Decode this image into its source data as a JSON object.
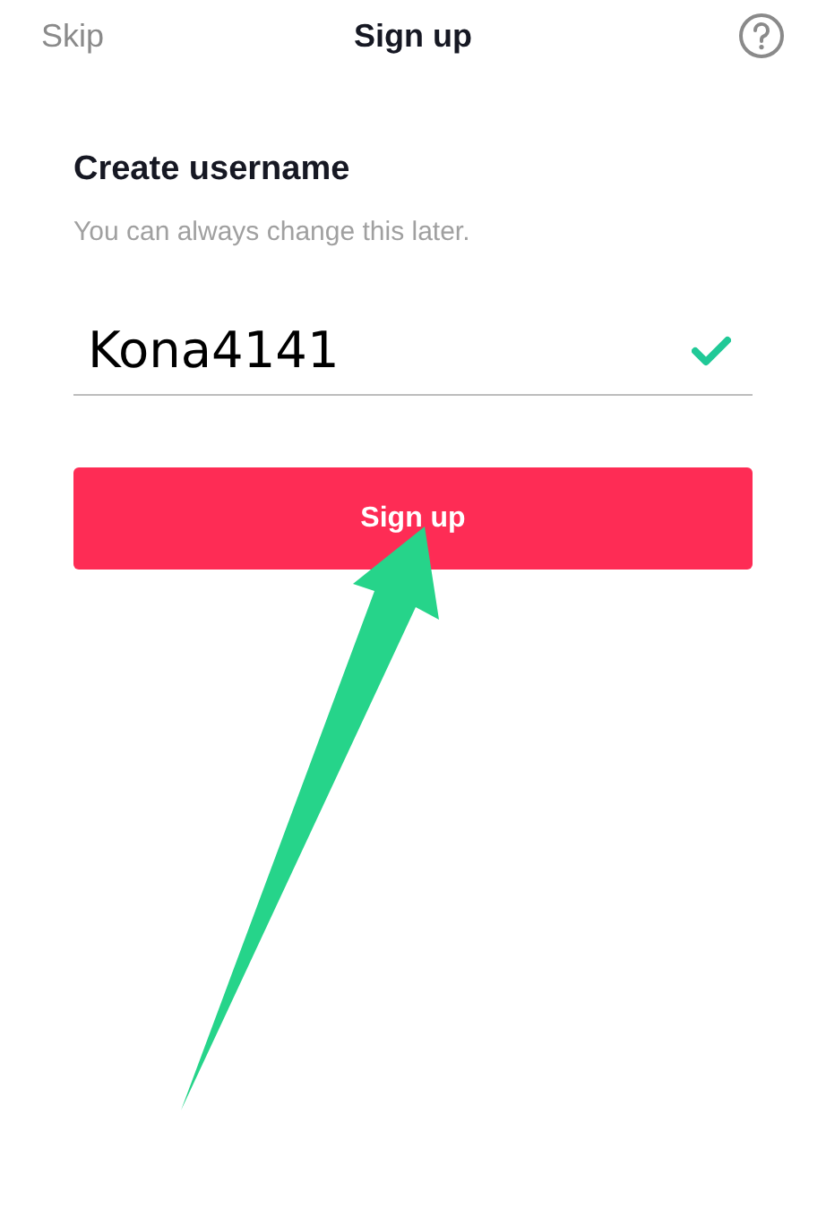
{
  "header": {
    "skip": "Skip",
    "title": "Sign up"
  },
  "form": {
    "heading": "Create username",
    "hint": "You can always change this later.",
    "username": "Kona4141",
    "valid": true
  },
  "buttons": [
    {
      "label": "Sign up",
      "kind": "primary"
    }
  ]
}
